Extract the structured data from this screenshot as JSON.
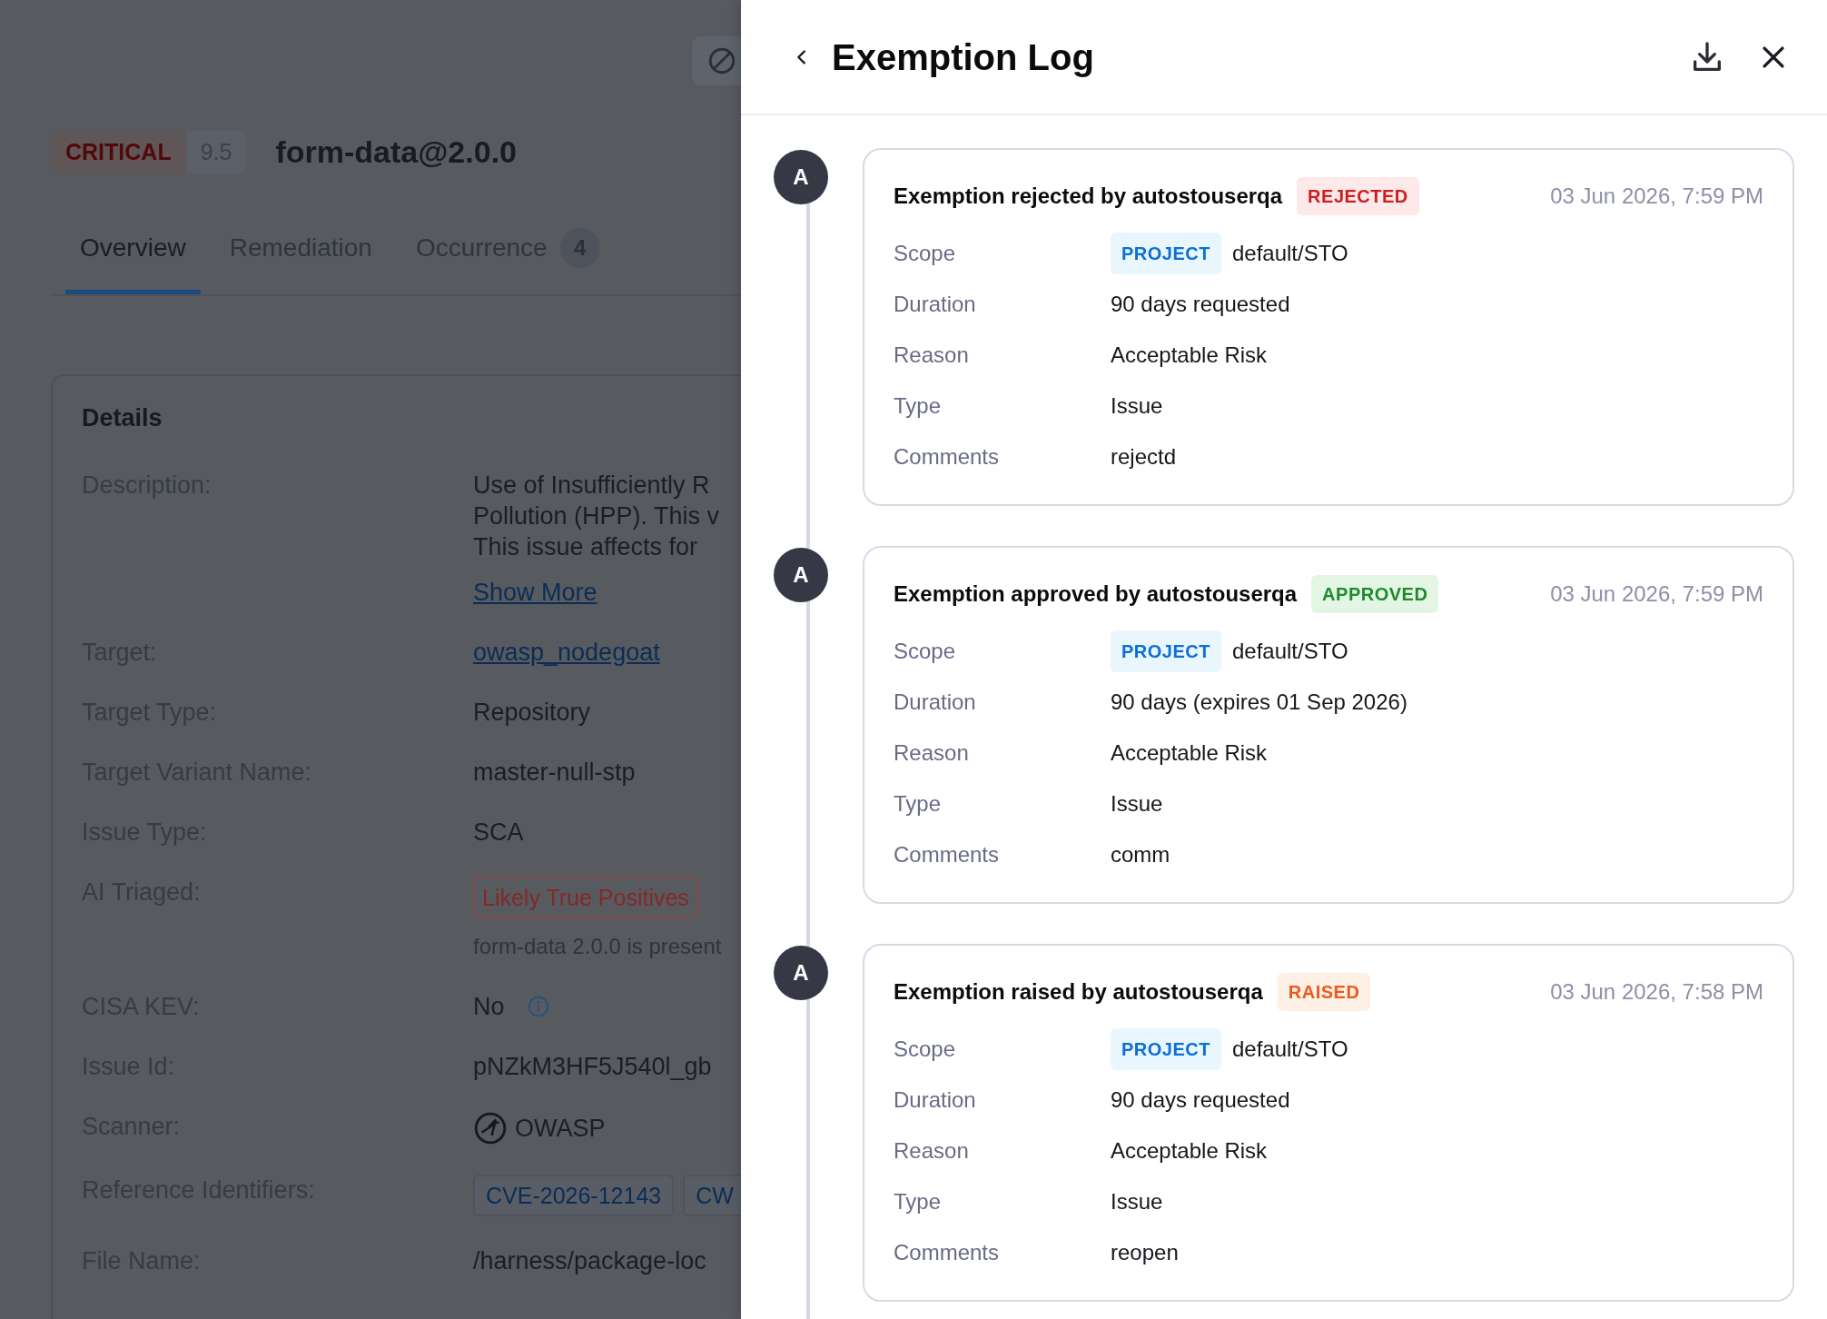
{
  "issue": {
    "severity": "CRITICAL",
    "score": "9.5",
    "title": "form-data@2.0.0"
  },
  "tabs": [
    {
      "label": "Overview",
      "selected": true
    },
    {
      "label": "Remediation",
      "selected": false
    },
    {
      "label": "Occurrence",
      "count": "4",
      "selected": false
    }
  ],
  "details": {
    "title": "Details",
    "fields": [
      {
        "label": "Description:",
        "kind": "text",
        "lines": [
          "Use of Insufficiently R",
          "Pollution (HPP). This v",
          "This issue affects for"
        ],
        "link": "Show More"
      },
      {
        "label": "Target:",
        "kind": "link",
        "value": "owasp_nodegoat"
      },
      {
        "label": "Target Type:",
        "kind": "plain",
        "value": "Repository"
      },
      {
        "label": "Target Variant Name:",
        "kind": "plain",
        "value": "master-null-stp"
      },
      {
        "label": "Issue Type:",
        "kind": "plain",
        "value": "SCA"
      },
      {
        "label": "AI Triaged:",
        "kind": "tag",
        "value": "Likely True Positives",
        "note": "form-data 2.0.0 is present"
      },
      {
        "label": "CISA KEV:",
        "kind": "info",
        "value": "No"
      },
      {
        "label": "Issue Id:",
        "kind": "plain",
        "value": "pNZkM3HF5J540l_gb"
      },
      {
        "label": "Scanner:",
        "kind": "scanner",
        "value": "OWASP"
      },
      {
        "label": "Reference Identifiers:",
        "kind": "chips",
        "values": [
          "CVE-2026-12143",
          "CW"
        ]
      },
      {
        "label": "File Name:",
        "kind": "plain",
        "value": "/harness/package-loc"
      }
    ]
  },
  "drawer": {
    "title": "Exemption Log",
    "entries": [
      {
        "avatar": "A",
        "title": "Exemption rejected by autostouserqa",
        "status": "REJECTED",
        "kind": "rejected",
        "time": "03 Jun 2026, 7:59 PM",
        "fields": [
          {
            "label": "Scope",
            "tag": "PROJECT",
            "value": "default/STO"
          },
          {
            "label": "Duration",
            "value": "90 days requested"
          },
          {
            "label": "Reason",
            "value": "Acceptable Risk"
          },
          {
            "label": "Type",
            "value": "Issue"
          },
          {
            "label": "Comments",
            "value": "rejectd"
          }
        ]
      },
      {
        "avatar": "A",
        "title": "Exemption approved by autostouserqa",
        "status": "APPROVED",
        "kind": "approved",
        "time": "03 Jun 2026, 7:59 PM",
        "fields": [
          {
            "label": "Scope",
            "tag": "PROJECT",
            "value": "default/STO"
          },
          {
            "label": "Duration",
            "value": "90 days (expires 01 Sep 2026)"
          },
          {
            "label": "Reason",
            "value": "Acceptable Risk"
          },
          {
            "label": "Type",
            "value": "Issue"
          },
          {
            "label": "Comments",
            "value": "comm"
          }
        ]
      },
      {
        "avatar": "A",
        "title": "Exemption raised by autostouserqa",
        "status": "RAISED",
        "kind": "raised",
        "time": "03 Jun 2026, 7:58 PM",
        "fields": [
          {
            "label": "Scope",
            "tag": "PROJECT",
            "value": "default/STO"
          },
          {
            "label": "Duration",
            "value": "90 days requested"
          },
          {
            "label": "Reason",
            "value": "Acceptable Risk"
          },
          {
            "label": "Type",
            "value": "Issue"
          },
          {
            "label": "Comments",
            "value": "reopen"
          }
        ]
      }
    ]
  }
}
